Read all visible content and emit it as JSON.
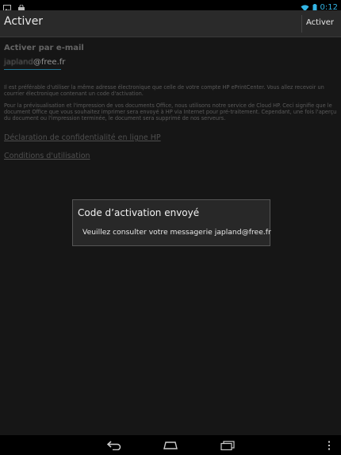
{
  "statusbar": {
    "left_icons": [
      "gallery-icon",
      "store-bag-icon"
    ],
    "time": "0:12",
    "right_icons": [
      "wifi-icon",
      "battery-icon"
    ]
  },
  "actionbar": {
    "title": "Activer",
    "action_label": "Activer"
  },
  "content": {
    "section_title": "Activer par e-mail",
    "email_value_blurred": "japland",
    "email_value_domain": "@free.fr",
    "paragraph_1": "Il est préférable d'utiliser la même adresse électronique que celle de votre compte HP ePrintCenter. Vous allez recevoir un courrier électronique contenant un code d'activation.",
    "paragraph_2": "Pour la prévisualisation et l'impression de vos documents Office, nous utilisons notre service de Cloud HP. Ceci signifie que le document Office que vous souhaitez imprimer sera envoyé à HP via Internet pour pré-traitement. Cependant, une fois l'aperçu du document ou l'impression terminée, le document sera supprimé de nos serveurs.",
    "link_privacy": "Déclaration de confidentialité en ligne HP",
    "link_terms": "Conditions d'utilisation"
  },
  "dialog": {
    "title": "Code d’activation envoyé",
    "message": "Veuillez consulter votre messagerie japland@free.fr"
  },
  "navbar": {
    "buttons": [
      "back-icon",
      "home-icon",
      "recent-apps-icon",
      "menu-icon"
    ]
  },
  "colors": {
    "accent": "#33b5e5",
    "background": "#222222",
    "dialog_bg": "#282828"
  }
}
